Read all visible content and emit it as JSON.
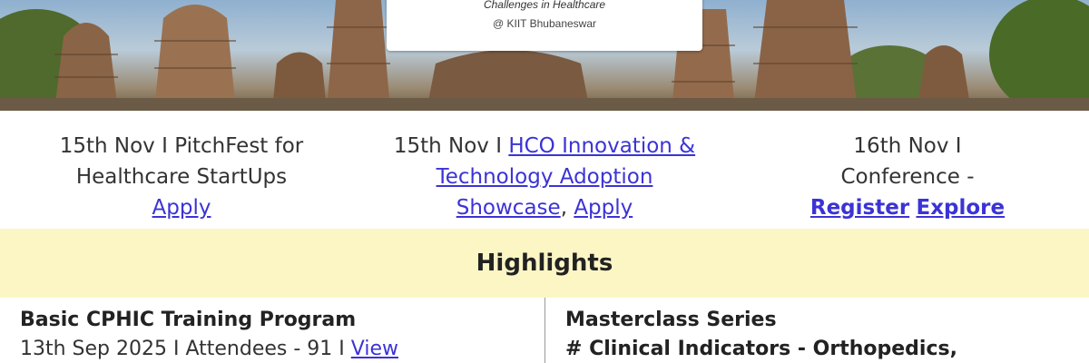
{
  "hero": {
    "subtitle": "Challenges in Healthcare",
    "venue": "@ KIIT Bhubaneswar"
  },
  "events": [
    {
      "line1": "15th Nov I PitchFest for",
      "line2": "Healthcare StartUps",
      "link": "Apply"
    },
    {
      "prefix": "15th Nov I ",
      "link_a1": "HCO Innovation &",
      "link_a2": "Technology Adoption",
      "link_a3": "Showcase",
      "separator": ",",
      "link_b": "Apply"
    },
    {
      "line1": "16th Nov I",
      "line2": "Conference -",
      "link_register": "Register",
      "link_explore": "Explore"
    }
  ],
  "highlights": {
    "title": "Highlights",
    "left": {
      "title": "Basic CPHIC Training Program",
      "meta": "13th Sep 2025 I Attendees - 91 I ",
      "link": "View"
    },
    "right": {
      "title": "Masterclass Series",
      "subtitle": "# Clinical Indicators - Orthopedics,"
    }
  },
  "colors": {
    "link": "#3b33d6",
    "highlight_bg": "#fbf6c4"
  }
}
